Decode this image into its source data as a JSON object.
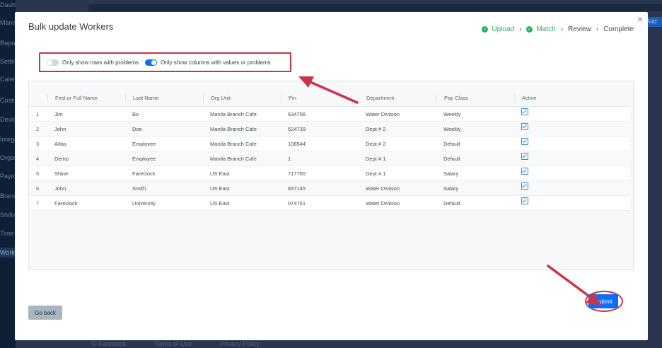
{
  "background": {
    "sidebar_items": [
      {
        "label": "Dashboard"
      },
      {
        "label": "Manage"
      },
      {
        "label": "Reports"
      },
      {
        "label": "Settings"
      },
      {
        "label": "Calendar"
      },
      {
        "label": "Costing"
      },
      {
        "label": "Devices"
      },
      {
        "label": "Integrations"
      },
      {
        "label": "Organization"
      },
      {
        "label": "Payroll"
      },
      {
        "label": "Branches"
      },
      {
        "label": "Shifts"
      },
      {
        "label": "Time Off"
      },
      {
        "label": "Workers"
      }
    ],
    "footer": {
      "brand": "© Fareclock",
      "terms": "Terms of Use",
      "privacy": "Privacy Policy"
    },
    "right_button": "Add"
  },
  "modal": {
    "title": "Bulk update Workers",
    "close_glyph": "×",
    "steps": [
      {
        "label": "Upload",
        "done": true
      },
      {
        "label": "Match",
        "done": true
      },
      {
        "label": "Review",
        "done": false
      },
      {
        "label": "Complete",
        "done": false
      }
    ],
    "step_separator": "›",
    "check_glyph": "✓",
    "toggles": {
      "rows_with_problems": {
        "label": "Only show rows with problems",
        "on": false
      },
      "columns_with_values": {
        "label": "Only show columns with values or problems",
        "on": true
      }
    },
    "table": {
      "columns": [
        "",
        "First or Full Name",
        "Last Name",
        "Org Unit",
        "Pin",
        "Department",
        "Pay Class",
        "Active"
      ],
      "rows": [
        {
          "idx": "1",
          "first": "Jim",
          "last": "Bo",
          "org": "Manila Branch Cafe",
          "pin": "634708",
          "dept": "Water Division",
          "pay": "Weekly",
          "active": true
        },
        {
          "idx": "2",
          "first": "John",
          "last": "Doe",
          "org": "Manila Branch Cafe",
          "pin": "624739",
          "dept": "Dept # 2",
          "pay": "Weekly",
          "active": true
        },
        {
          "idx": "3",
          "first": "Atlas",
          "last": "Employee",
          "org": "Manila Branch Cafe",
          "pin": "106544",
          "dept": "Dept # 2",
          "pay": "Default",
          "active": true
        },
        {
          "idx": "4",
          "first": "Demo",
          "last": "Employee",
          "org": "Manila Branch Cafe",
          "pin": "1",
          "dept": "Dept # 1",
          "pay": "Default",
          "active": true
        },
        {
          "idx": "5",
          "first": "Shine",
          "last": "Fareclock",
          "org": "US East",
          "pin": "717765",
          "dept": "Dept # 1",
          "pay": "Salary",
          "active": true
        },
        {
          "idx": "6",
          "first": "John",
          "last": "Smith",
          "org": "US East",
          "pin": "837145",
          "dept": "Water Division",
          "pay": "Salary",
          "active": true
        },
        {
          "idx": "7",
          "first": "Fareclock",
          "last": "University",
          "org": "US East",
          "pin": "074761",
          "dept": "Water Division",
          "pay": "Default",
          "active": true
        }
      ]
    },
    "buttons": {
      "back": "Go back",
      "submit": "Submit"
    }
  },
  "colors": {
    "highlight_red": "#c9344a",
    "primary_blue": "#0d6efd",
    "step_green": "#27ae60",
    "back_button_gray": "#a9b6c0"
  }
}
